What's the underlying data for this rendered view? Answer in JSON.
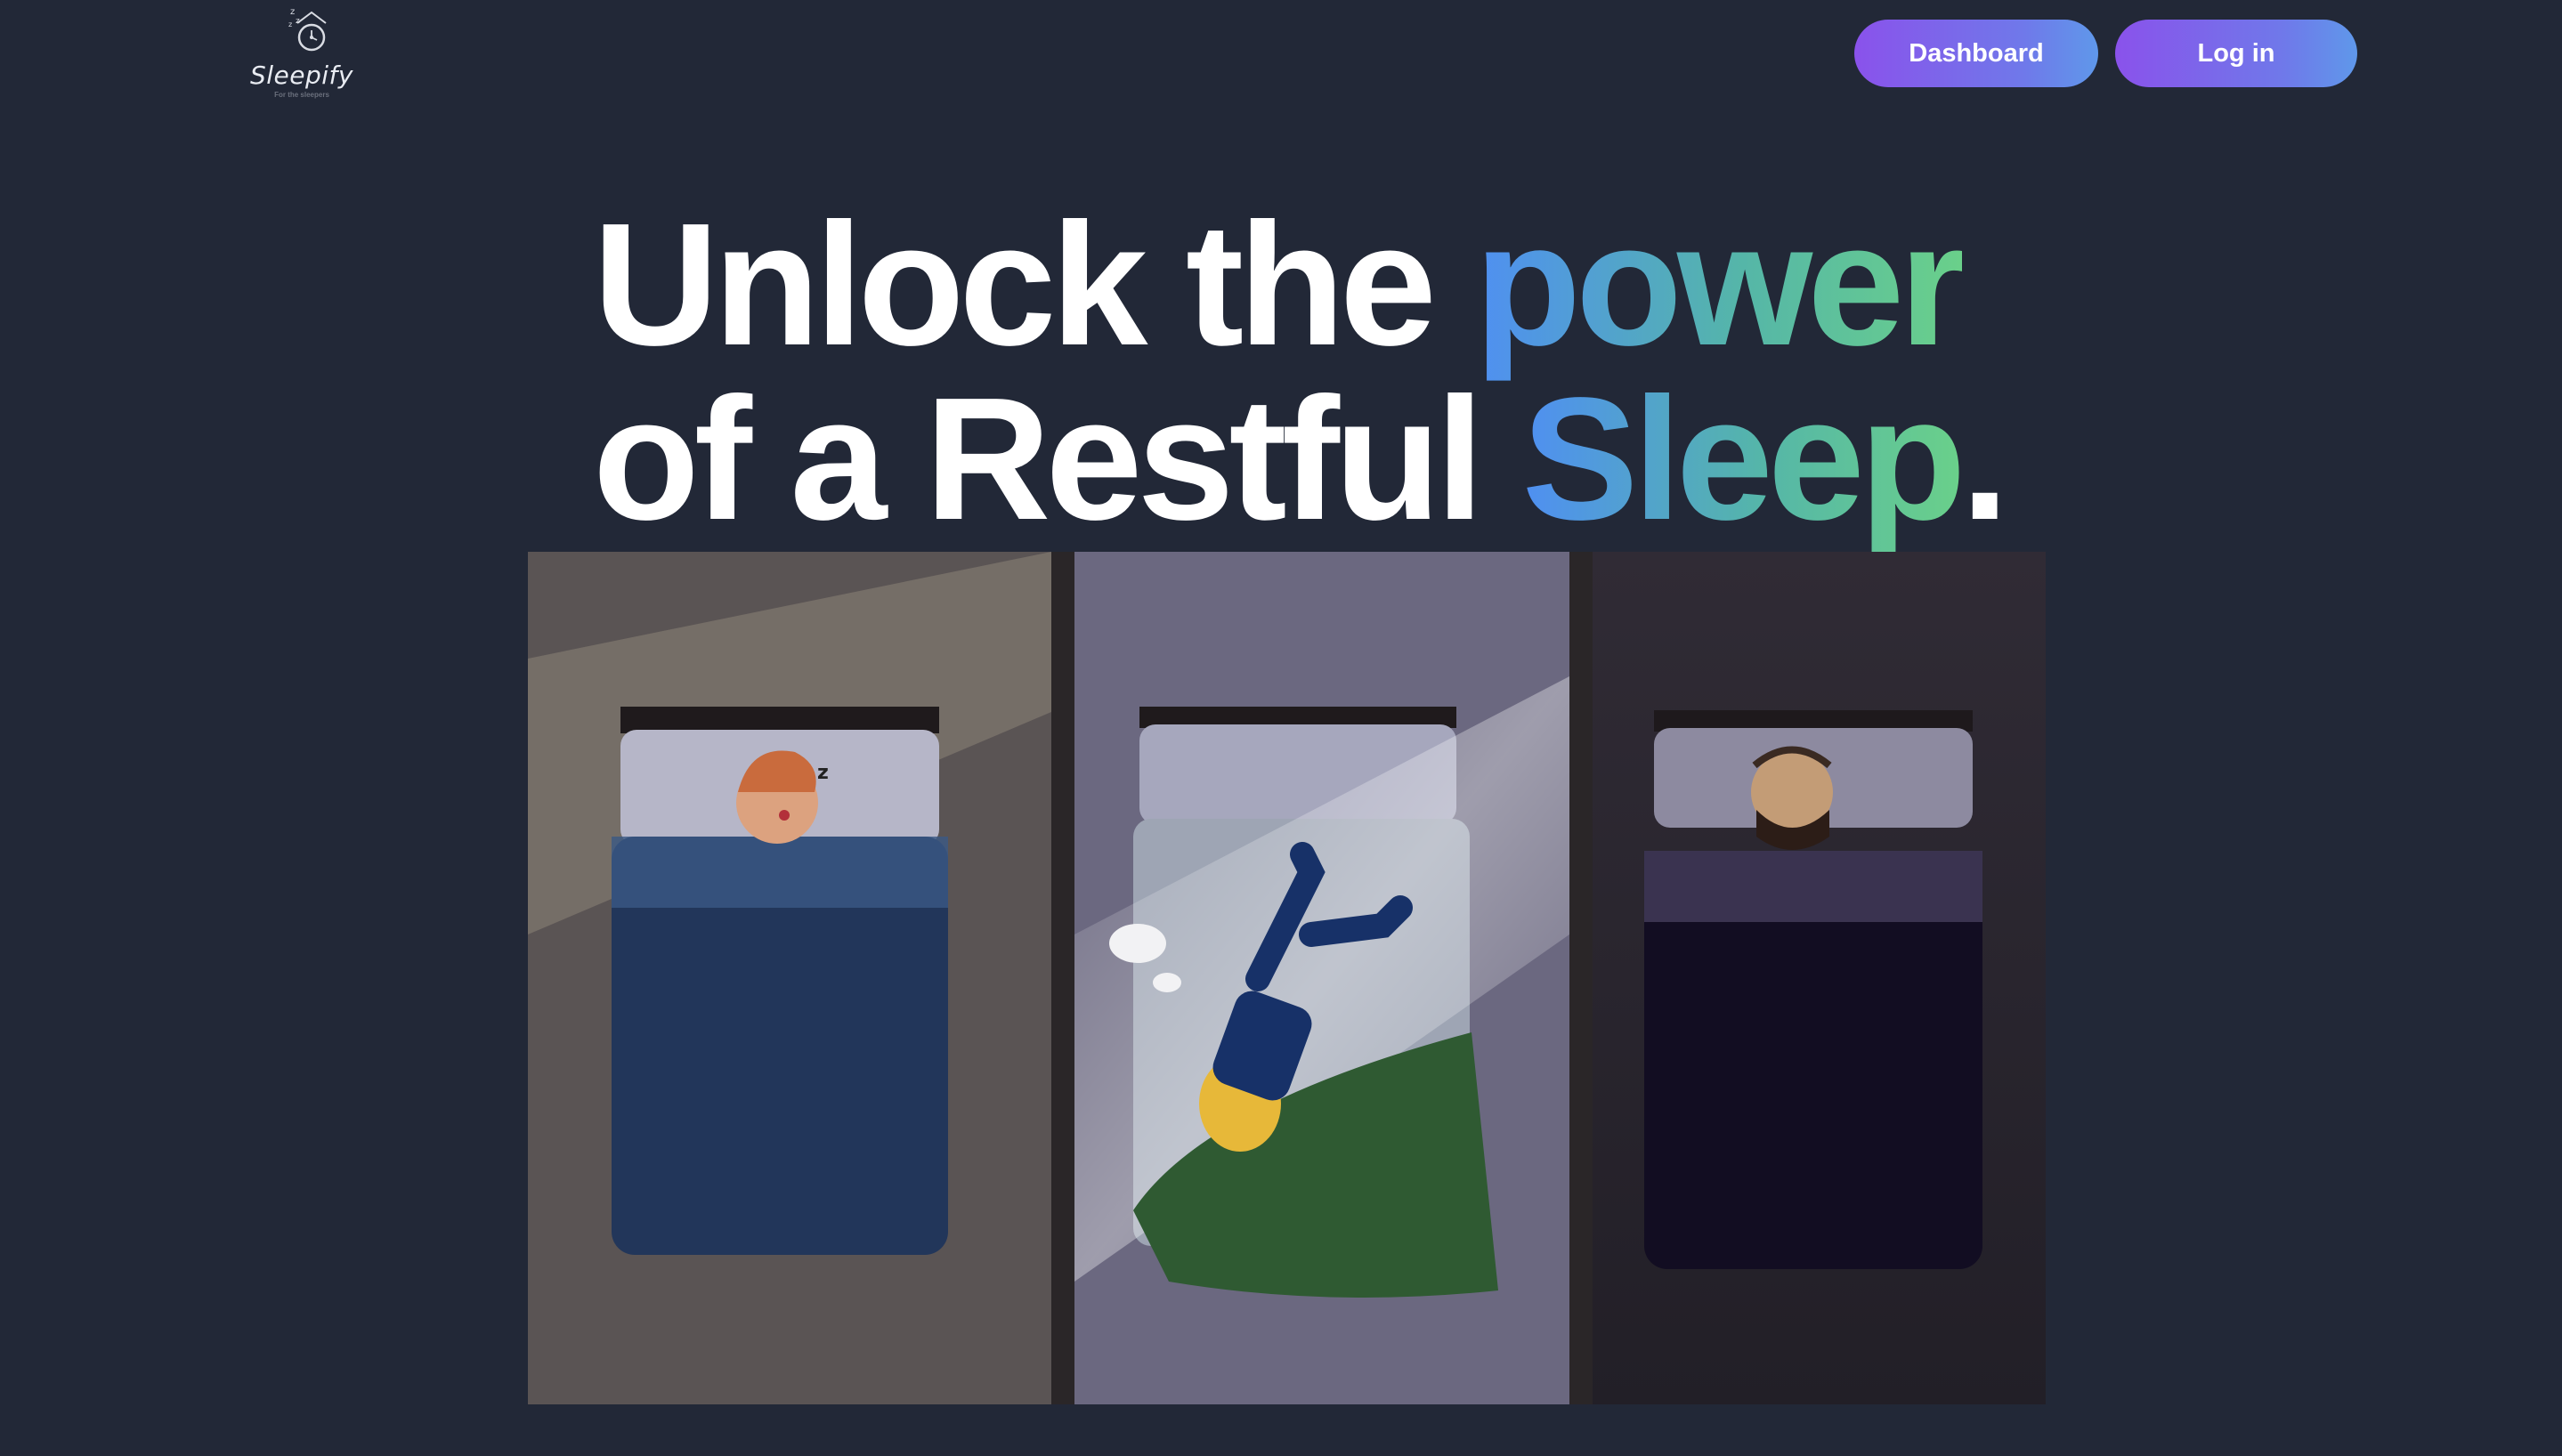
{
  "header": {
    "logo": {
      "name": "Sleepify",
      "tagline": "For the sleepers",
      "icon": "sleeping-house-icon"
    },
    "nav": {
      "dashboard_label": "Dashboard",
      "login_label": "Log in"
    }
  },
  "hero": {
    "line1_plain": "Unlock the ",
    "line1_highlight": "power",
    "line2_plain": "of a Restful ",
    "line2_highlight": "Sleep",
    "line2_end": ".",
    "image_description_icon": "sleepers-illustration"
  },
  "colors": {
    "background": "#222837",
    "button_gradient_start": "#8a52eb",
    "button_gradient_end": "#5f98ea",
    "highlight_gradient_start": "#4f8ff2",
    "highlight_gradient_end": "#6ad08a"
  }
}
